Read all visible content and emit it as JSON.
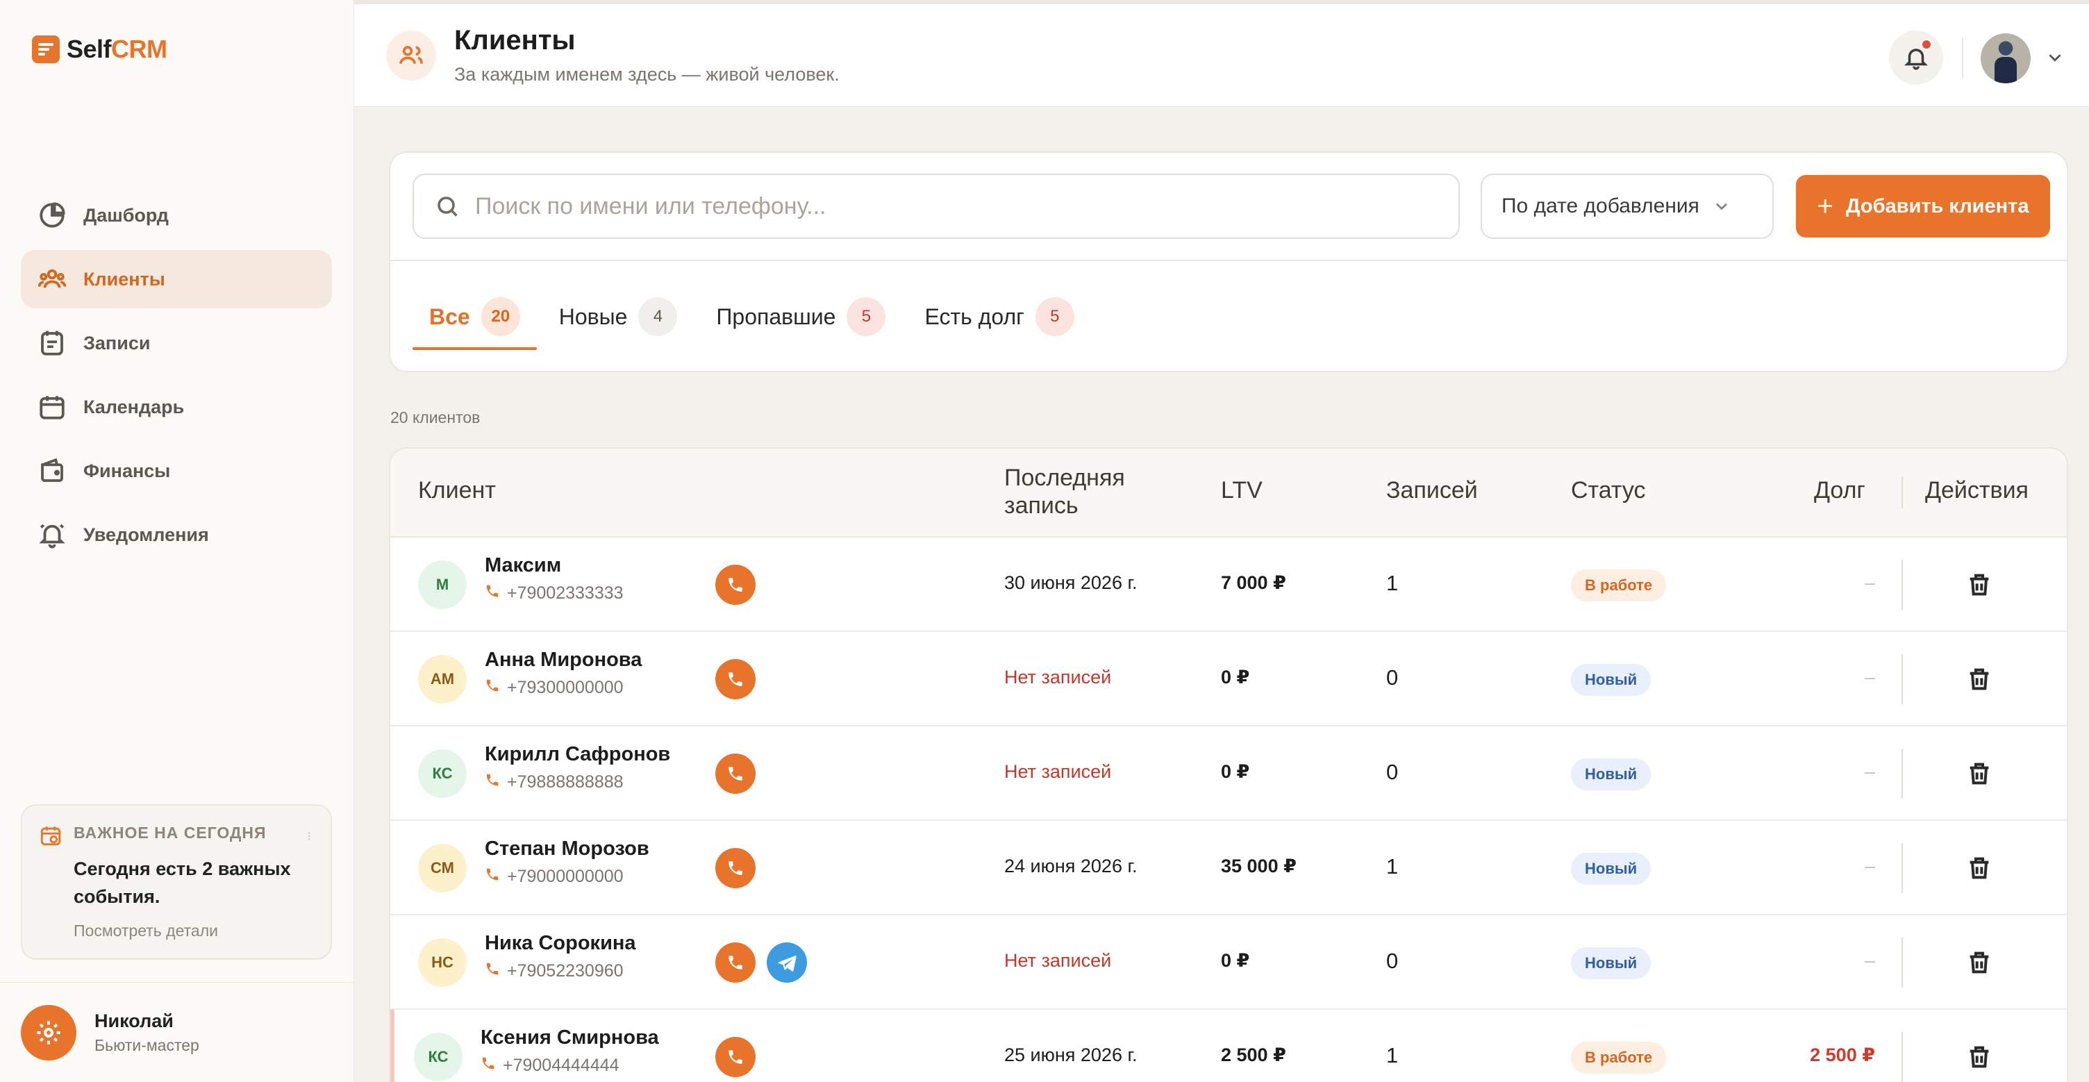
{
  "brand": {
    "prefix": "Self",
    "accent": "CRM"
  },
  "nav": [
    {
      "label": "Дашборд",
      "icon": "pie-chart-icon"
    },
    {
      "label": "Клиенты",
      "icon": "users-icon",
      "active": true
    },
    {
      "label": "Записи",
      "icon": "notes-icon"
    },
    {
      "label": "Календарь",
      "icon": "calendar-icon"
    },
    {
      "label": "Финансы",
      "icon": "wallet-icon"
    },
    {
      "label": "Уведомления",
      "icon": "bell-icon"
    }
  ],
  "today": {
    "kicker": "ВАЖНОЕ НА СЕГОДНЯ",
    "title": "Сегодня есть 2 важных события.",
    "link": "Посмотреть детали"
  },
  "user": {
    "name": "Николай",
    "role": "Бьюти-мастер"
  },
  "header": {
    "title": "Клиенты",
    "subtitle": "За каждым именем здесь — живой человек."
  },
  "toolbar": {
    "search_placeholder": "Поиск по имени или телефону...",
    "sort_value": "По дате добавления",
    "add_label": "Добавить клиента"
  },
  "tabs": [
    {
      "label": "Все",
      "count": "20",
      "active": true,
      "badge": "orange"
    },
    {
      "label": "Новые",
      "count": "4",
      "badge": "gray"
    },
    {
      "label": "Пропавшие",
      "count": "5",
      "badge": "red"
    },
    {
      "label": "Есть долг",
      "count": "5",
      "badge": "red"
    }
  ],
  "count_label": "20 клиентов",
  "table": {
    "columns": {
      "client": "Клиент",
      "last_line1": "Последняя",
      "last_line2": "запись",
      "ltv": "LTV",
      "visits": "Записей",
      "status": "Статус",
      "debt": "Долг",
      "actions": "Действия"
    },
    "rows": [
      {
        "initials": "М",
        "name": "Максим",
        "phone": "+79002333333",
        "last": "30 июня 2026 г.",
        "ltv": "7 000 ₽",
        "visits": "1",
        "status": "В работе",
        "debt": "–",
        "avatar": "green",
        "telegram": false
      },
      {
        "initials": "АМ",
        "name": "Анна Миронова",
        "phone": "+79300000000",
        "last": "Нет записей",
        "ltv": "0 ₽",
        "visits": "0",
        "status": "Новый",
        "debt": "–",
        "avatar": "yellow",
        "telegram": false
      },
      {
        "initials": "КС",
        "name": "Кирилл Сафронов",
        "phone": "+79888888888",
        "last": "Нет записей",
        "ltv": "0 ₽",
        "visits": "0",
        "status": "Новый",
        "debt": "–",
        "avatar": "green",
        "telegram": false
      },
      {
        "initials": "СМ",
        "name": "Степан Морозов",
        "phone": "+79000000000",
        "last": "24 июня 2026 г.",
        "ltv": "35 000 ₽",
        "visits": "1",
        "status": "Новый",
        "debt": "–",
        "avatar": "yellow",
        "telegram": false
      },
      {
        "initials": "НС",
        "name": "Ника Сорокина",
        "phone": "+79052230960",
        "last": "Нет записей",
        "ltv": "0 ₽",
        "visits": "0",
        "status": "Новый",
        "debt": "–",
        "avatar": "yellow",
        "telegram": true
      },
      {
        "initials": "КС",
        "name": "Ксения Смирнова",
        "phone": "+79004444444",
        "last": "25 июня 2026 г.",
        "ltv": "2 500 ₽",
        "visits": "1",
        "status": "В работе",
        "debt": "2 500 ₽",
        "avatar": "green",
        "telegram": false
      }
    ]
  },
  "colors": {
    "accent": "#e8742c",
    "danger": "#d03a2a",
    "telegram": "#3d9be0"
  }
}
